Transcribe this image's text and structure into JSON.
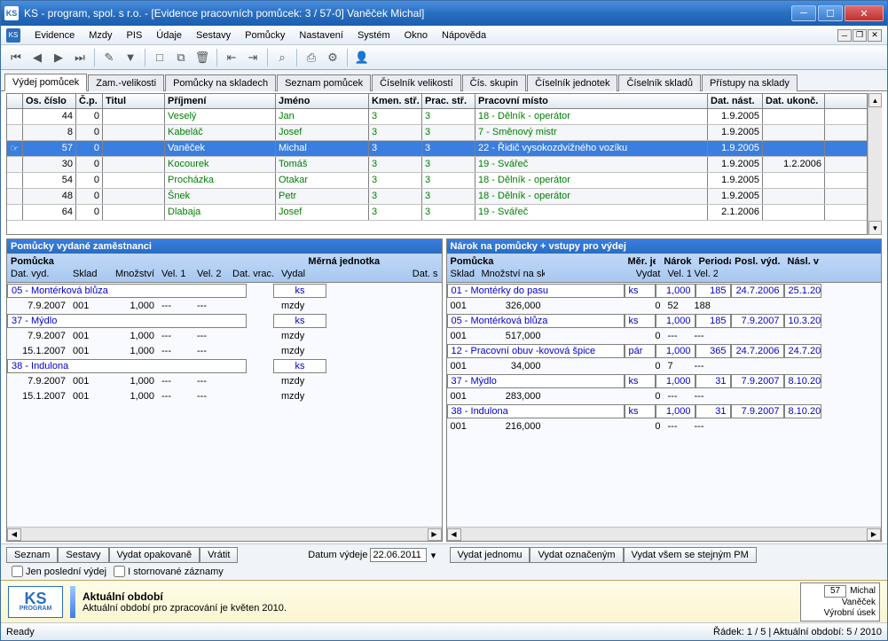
{
  "window": {
    "title": "KS - program, spol. s r.o. - [Evidence pracovních pomůcek: 3 / 57-0] Vaněček Michal]"
  },
  "menu": [
    "Evidence",
    "Mzdy",
    "PIS",
    "Údaje",
    "Sestavy",
    "Pomůcky",
    "Nastavení",
    "Systém",
    "Okno",
    "Nápověda"
  ],
  "tabs": [
    "Výdej pomůcek",
    "Zam.-velikosti",
    "Pomůcky na skladech",
    "Seznam pomůcek",
    "Číselník velikostí",
    "Čís. skupin",
    "Číselník jednotek",
    "Číselník skladů",
    "Přístupy na sklady"
  ],
  "active_tab": 0,
  "emp_headers": [
    "Os. číslo",
    "Č.p.",
    "Titul",
    "Příjmení",
    "Jméno",
    "Kmen. stř.",
    "Prac. stř.",
    "Pracovní místo",
    "Dat. nást.",
    "Dat. ukonč."
  ],
  "employees": [
    {
      "os": "44",
      "cp": "0",
      "tit": "",
      "prij": "Veselý",
      "jm": "Jan",
      "km": "3",
      "pr": "3",
      "pm": "18 - Dělník - operátor",
      "dn": "1.9.2005",
      "du": ""
    },
    {
      "os": "8",
      "cp": "0",
      "tit": "",
      "prij": "Kabeláč",
      "jm": "Josef",
      "km": "3",
      "pr": "3",
      "pm": "7 - Směnový mistr",
      "dn": "1.9.2005",
      "du": ""
    },
    {
      "os": "57",
      "cp": "0",
      "tit": "",
      "prij": "Vaněček",
      "jm": "Michal",
      "km": "3",
      "pr": "3",
      "pm": "22 - Řidič vysokozdvižného vozíku",
      "dn": "1.9.2005",
      "du": "",
      "selected": true
    },
    {
      "os": "30",
      "cp": "0",
      "tit": "",
      "prij": "Kocourek",
      "jm": "Tomáš",
      "km": "3",
      "pr": "3",
      "pm": "19 - Svářeč",
      "dn": "1.9.2005",
      "du": "1.2.2006"
    },
    {
      "os": "54",
      "cp": "0",
      "tit": "",
      "prij": "Procházka",
      "jm": "Otakar",
      "km": "3",
      "pr": "3",
      "pm": "18 - Dělník - operátor",
      "dn": "1.9.2005",
      "du": ""
    },
    {
      "os": "48",
      "cp": "0",
      "tit": "",
      "prij": "Šnek",
      "jm": "Petr",
      "km": "3",
      "pr": "3",
      "pm": "18 - Dělník - operátor",
      "dn": "1.9.2005",
      "du": ""
    },
    {
      "os": "64",
      "cp": "0",
      "tit": "",
      "prij": "Dlabaja",
      "jm": "Josef",
      "km": "3",
      "pr": "3",
      "pm": "19 - Svářeč",
      "dn": "2.1.2006",
      "du": ""
    }
  ],
  "left_panel": {
    "title": "Pomůcky vydané zaměstnanci",
    "head1": {
      "pomucka": "Pomůcka",
      "mj": "Měrná jednotka"
    },
    "head2": {
      "date": "Dat. vyd.",
      "sklad": "Sklad",
      "mn": "Množství",
      "v1": "Vel. 1",
      "v2": "Vel. 2",
      "dv": "Dat. vrac.",
      "vyd": "Vydal",
      "ds": "Dat. s"
    },
    "items": [
      {
        "name": "05 - Montérková blůza",
        "mj": "ks",
        "rows": [
          {
            "date": "7.9.2007",
            "skl": "001",
            "mn": "1,000",
            "v1": "---",
            "v2": "---",
            "dv": "",
            "vyd": "mzdy"
          }
        ]
      },
      {
        "name": "37 - Mýdlo",
        "mj": "ks",
        "rows": [
          {
            "date": "7.9.2007",
            "skl": "001",
            "mn": "1,000",
            "v1": "---",
            "v2": "---",
            "dv": "",
            "vyd": "mzdy"
          },
          {
            "date": "15.1.2007",
            "skl": "001",
            "mn": "1,000",
            "v1": "---",
            "v2": "---",
            "dv": "",
            "vyd": "mzdy"
          }
        ]
      },
      {
        "name": "38 - Indulona",
        "mj": "ks",
        "rows": [
          {
            "date": "7.9.2007",
            "skl": "001",
            "mn": "1,000",
            "v1": "---",
            "v2": "---",
            "dv": "",
            "vyd": "mzdy"
          },
          {
            "date": "15.1.2007",
            "skl": "001",
            "mn": "1,000",
            "v1": "---",
            "v2": "---",
            "dv": "",
            "vyd": "mzdy"
          }
        ]
      }
    ]
  },
  "right_panel": {
    "title": "Nárok na pomůcky + vstupy pro výdej",
    "head1": {
      "pomucka": "Pomůcka",
      "mj": "Měr. jedn.",
      "nar": "Nárok",
      "per": "Perioda",
      "pv": "Posl. výd.",
      "nv": "Násl. v"
    },
    "head2": {
      "sklad": "Sklad",
      "mns": "Množství na skl.",
      "vy": "Vydat",
      "v1": "Vel. 1",
      "v2": "Vel. 2"
    },
    "items": [
      {
        "name": "01 - Montérky do pasu",
        "mj": "ks",
        "nar": "1,000",
        "per": "185",
        "pv": "24.7.2006",
        "nv": "25.1.20",
        "sub": {
          "skl": "001",
          "mns": "326,000",
          "vy": "0",
          "v1": "52",
          "v2": "188"
        }
      },
      {
        "name": "05 - Montérková blůza",
        "mj": "ks",
        "nar": "1,000",
        "per": "185",
        "pv": "7.9.2007",
        "nv": "10.3.20",
        "sub": {
          "skl": "001",
          "mns": "517,000",
          "vy": "0",
          "v1": "---",
          "v2": "---"
        }
      },
      {
        "name": "12 - Pracovní obuv -kovová špice",
        "mj": "pár",
        "nar": "1,000",
        "per": "365",
        "pv": "24.7.2006",
        "nv": "24.7.20",
        "sub": {
          "skl": "001",
          "mns": "34,000",
          "vy": "0",
          "v1": "7",
          "v2": "---"
        }
      },
      {
        "name": "37 - Mýdlo",
        "mj": "ks",
        "nar": "1,000",
        "per": "31",
        "pv": "7.9.2007",
        "nv": "8.10.20",
        "sub": {
          "skl": "001",
          "mns": "283,000",
          "vy": "0",
          "v1": "---",
          "v2": "---"
        }
      },
      {
        "name": "38 - Indulona",
        "mj": "ks",
        "nar": "1,000",
        "per": "31",
        "pv": "7.9.2007",
        "nv": "8.10.20",
        "sub": {
          "skl": "001",
          "mns": "216,000",
          "vy": "0",
          "v1": "---",
          "v2": "---"
        }
      }
    ]
  },
  "bottom_left": {
    "buttons": [
      "Seznam",
      "Sestavy",
      "Vydat opakovaně",
      "Vrátit"
    ],
    "date_label": "Datum výdeje",
    "date_value": "22.06.2011",
    "chk1": "Jen poslední výdej",
    "chk2": "I stornované záznamy"
  },
  "bottom_right": {
    "buttons": [
      "Vydat jednomu",
      "Vydat označeným",
      "Vydat všem se stejným PM"
    ]
  },
  "footer": {
    "title": "Aktuální období",
    "text": "Aktuální období pro zpracování je květen 2010.",
    "card_id": "57",
    "card_name": "Michal",
    "card_surname": "Vaněček",
    "card_dept": "Výrobní úsek"
  },
  "status": {
    "left": "Ready",
    "right": "Řádek: 1 / 5  |  Aktuální období: 5 / 2010"
  }
}
